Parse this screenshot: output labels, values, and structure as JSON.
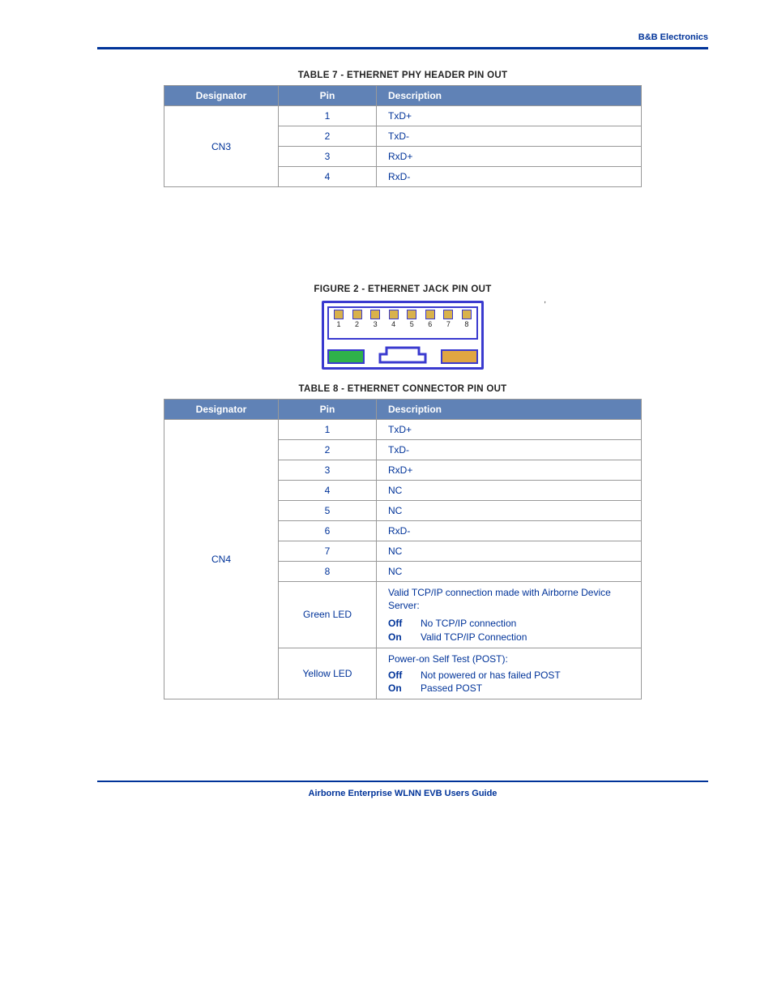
{
  "header": {
    "company": "B&B Electronics"
  },
  "table7": {
    "caption": "TABLE 7 - ETHERNET PHY HEADER PIN OUT",
    "headers": {
      "des": "Designator",
      "pin": "Pin",
      "desc": "Description"
    },
    "designator": "CN3",
    "rows": [
      {
        "pin": "1",
        "desc": "TxD+"
      },
      {
        "pin": "2",
        "desc": "TxD-"
      },
      {
        "pin": "3",
        "desc": "RxD+"
      },
      {
        "pin": "4",
        "desc": "RxD-"
      }
    ]
  },
  "figure2": {
    "caption": "FIGURE 2 - ETHERNET JACK PIN OUT",
    "pins": [
      "1",
      "2",
      "3",
      "4",
      "5",
      "6",
      "7",
      "8"
    ]
  },
  "table8": {
    "caption": "TABLE 8 - ETHERNET CONNECTOR PIN OUT",
    "headers": {
      "des": "Designator",
      "pin": "Pin",
      "desc": "Description"
    },
    "designator": "CN4",
    "rows": [
      {
        "pin": "1",
        "desc": "TxD+"
      },
      {
        "pin": "2",
        "desc": "TxD-"
      },
      {
        "pin": "3",
        "desc": "RxD+"
      },
      {
        "pin": "4",
        "desc": "NC"
      },
      {
        "pin": "5",
        "desc": "NC"
      },
      {
        "pin": "6",
        "desc": "RxD-"
      },
      {
        "pin": "7",
        "desc": "NC"
      },
      {
        "pin": "8",
        "desc": "NC"
      }
    ],
    "leds": [
      {
        "pin": "Green LED",
        "intro": "Valid TCP/IP connection made with Airborne Device Server:",
        "states": [
          {
            "label": "Off",
            "text": "No TCP/IP connection"
          },
          {
            "label": "On",
            "text": "Valid TCP/IP Connection"
          }
        ]
      },
      {
        "pin": "Yellow LED",
        "intro": "Power-on Self Test (POST):",
        "states": [
          {
            "label": "Off",
            "text": "Not powered or has failed POST"
          },
          {
            "label": "On",
            "text": "Passed POST"
          }
        ]
      }
    ]
  },
  "footer": {
    "text": "Airborne Enterprise WLNN EVB Users Guide"
  },
  "tick": ","
}
